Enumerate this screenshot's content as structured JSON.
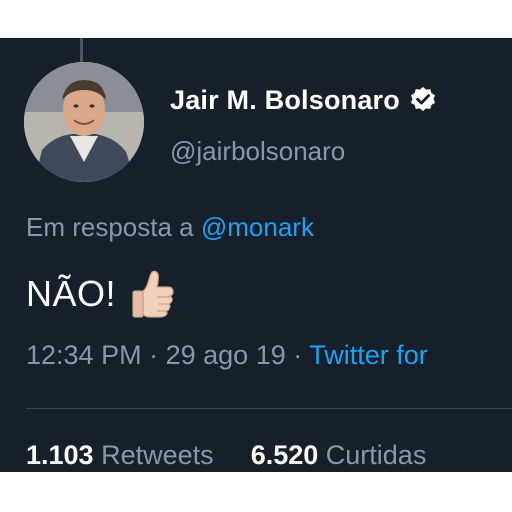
{
  "tweet": {
    "author": {
      "display_name": "Jair M. Bolsonaro",
      "handle": "@jairbolsonaro",
      "verified": true
    },
    "reply": {
      "prefix": "Em resposta a",
      "mention": "@monark"
    },
    "text": "NÃO!",
    "emoji": "thumbs-up",
    "meta": {
      "time": "12:34 PM",
      "separator": "·",
      "date": "29 ago 19",
      "source": "Twitter for"
    },
    "stats": {
      "retweets_count": "1.103",
      "retweets_label": "Retweets",
      "likes_count": "6.520",
      "likes_label": "Curtidas"
    }
  },
  "colors": {
    "background": "#15202b",
    "primary_text": "#ffffff",
    "secondary_text": "#8899a6",
    "link": "#1da1f2",
    "divider": "#38444d"
  },
  "icons": {
    "verified": "verified-badge-icon",
    "thumbs_up": "thumbs-up-emoji"
  }
}
